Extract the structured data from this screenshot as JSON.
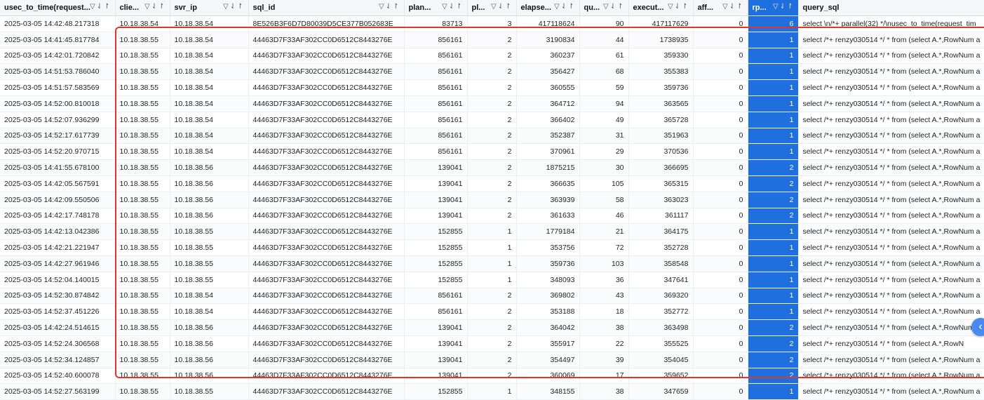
{
  "columns": [
    {
      "key": "usec",
      "label": "usec_to_time(request...",
      "num": false
    },
    {
      "key": "client",
      "label": "clie...",
      "num": false
    },
    {
      "key": "svr",
      "label": "svr_ip",
      "num": false
    },
    {
      "key": "sql",
      "label": "sql_id",
      "num": false
    },
    {
      "key": "plan",
      "label": "plan...",
      "num": true
    },
    {
      "key": "pl",
      "label": "pl...",
      "num": true
    },
    {
      "key": "elapse",
      "label": "elapse...",
      "num": true
    },
    {
      "key": "qu",
      "label": "qu...",
      "num": true
    },
    {
      "key": "execut",
      "label": "execut...",
      "num": true
    },
    {
      "key": "aff",
      "label": "aff...",
      "num": true
    },
    {
      "key": "rp",
      "label": "rp...",
      "num": true
    },
    {
      "key": "query",
      "label": "query_sql",
      "num": false
    }
  ],
  "header_icons": {
    "filter": "▽",
    "sort": "⇃↾"
  },
  "highlight_color": "#1f6fde",
  "selection_color": "#e0352b",
  "rows": [
    [
      "2025-03-05 14:42:48.217318",
      "10.18.38.54",
      "10.18.38.54",
      "8E526B3F6D7D80039D5CE377B052683E",
      "83713",
      "3",
      "417118624",
      "90",
      "417117629",
      "0",
      "6",
      "select \\n/*+ parallel(32) */\\nusec_to_time(request_tim"
    ],
    [
      "2025-03-05 14:41:45.817784",
      "10.18.38.55",
      "10.18.38.54",
      "44463D7F33AF302CC0D6512C8443276E",
      "856161",
      "2",
      "3190834",
      "44",
      "1738935",
      "0",
      "1",
      "select /*+ renzy030514 */ * from (select A.*,RowNum a"
    ],
    [
      "2025-03-05 14:42:01.720842",
      "10.18.38.55",
      "10.18.38.54",
      "44463D7F33AF302CC0D6512C8443276E",
      "856161",
      "2",
      "360237",
      "61",
      "359330",
      "0",
      "1",
      "select /*+ renzy030514 */ * from (select A.*,RowNum a"
    ],
    [
      "2025-03-05 14:51:53.786040",
      "10.18.38.55",
      "10.18.38.54",
      "44463D7F33AF302CC0D6512C8443276E",
      "856161",
      "2",
      "356427",
      "68",
      "355383",
      "0",
      "1",
      "select /*+ renzy030514 */ * from (select A.*,RowNum a"
    ],
    [
      "2025-03-05 14:51:57.583569",
      "10.18.38.55",
      "10.18.38.54",
      "44463D7F33AF302CC0D6512C8443276E",
      "856161",
      "2",
      "360555",
      "59",
      "359736",
      "0",
      "1",
      "select /*+ renzy030514 */ * from (select A.*,RowNum a"
    ],
    [
      "2025-03-05 14:52:00.810018",
      "10.18.38.55",
      "10.18.38.54",
      "44463D7F33AF302CC0D6512C8443276E",
      "856161",
      "2",
      "364712",
      "94",
      "363565",
      "0",
      "1",
      "select /*+ renzy030514 */ * from (select A.*,RowNum a"
    ],
    [
      "2025-03-05 14:52:07.936299",
      "10.18.38.55",
      "10.18.38.54",
      "44463D7F33AF302CC0D6512C8443276E",
      "856161",
      "2",
      "366402",
      "49",
      "365728",
      "0",
      "1",
      "select /*+ renzy030514 */ * from (select A.*,RowNum a"
    ],
    [
      "2025-03-05 14:52:17.617739",
      "10.18.38.55",
      "10.18.38.54",
      "44463D7F33AF302CC0D6512C8443276E",
      "856161",
      "2",
      "352387",
      "31",
      "351963",
      "0",
      "1",
      "select /*+ renzy030514 */ * from (select A.*,RowNum a"
    ],
    [
      "2025-03-05 14:52:20.970715",
      "10.18.38.55",
      "10.18.38.54",
      "44463D7F33AF302CC0D6512C8443276E",
      "856161",
      "2",
      "370961",
      "29",
      "370536",
      "0",
      "1",
      "select /*+ renzy030514 */ * from (select A.*,RowNum a"
    ],
    [
      "2025-03-05 14:41:55.678100",
      "10.18.38.55",
      "10.18.38.56",
      "44463D7F33AF302CC0D6512C8443276E",
      "139041",
      "2",
      "1875215",
      "30",
      "366695",
      "0",
      "2",
      "select /*+ renzy030514 */ * from (select A.*,RowNum a"
    ],
    [
      "2025-03-05 14:42:05.567591",
      "10.18.38.55",
      "10.18.38.56",
      "44463D7F33AF302CC0D6512C8443276E",
      "139041",
      "2",
      "366635",
      "105",
      "365315",
      "0",
      "2",
      "select /*+ renzy030514 */ * from (select A.*,RowNum a"
    ],
    [
      "2025-03-05 14:42:09.550506",
      "10.18.38.55",
      "10.18.38.56",
      "44463D7F33AF302CC0D6512C8443276E",
      "139041",
      "2",
      "363939",
      "58",
      "363023",
      "0",
      "2",
      "select /*+ renzy030514 */ * from (select A.*,RowNum a"
    ],
    [
      "2025-03-05 14:42:17.748178",
      "10.18.38.55",
      "10.18.38.56",
      "44463D7F33AF302CC0D6512C8443276E",
      "139041",
      "2",
      "361633",
      "46",
      "361117",
      "0",
      "2",
      "select /*+ renzy030514 */ * from (select A.*,RowNum a"
    ],
    [
      "2025-03-05 14:42:13.042386",
      "10.18.38.55",
      "10.18.38.55",
      "44463D7F33AF302CC0D6512C8443276E",
      "152855",
      "1",
      "1779184",
      "21",
      "364175",
      "0",
      "1",
      "select /*+ renzy030514 */ * from (select A.*,RowNum a"
    ],
    [
      "2025-03-05 14:42:21.221947",
      "10.18.38.55",
      "10.18.38.55",
      "44463D7F33AF302CC0D6512C8443276E",
      "152855",
      "1",
      "353756",
      "72",
      "352728",
      "0",
      "1",
      "select /*+ renzy030514 */ * from (select A.*,RowNum a"
    ],
    [
      "2025-03-05 14:42:27.961946",
      "10.18.38.55",
      "10.18.38.55",
      "44463D7F33AF302CC0D6512C8443276E",
      "152855",
      "1",
      "359736",
      "103",
      "358548",
      "0",
      "1",
      "select /*+ renzy030514 */ * from (select A.*,RowNum a"
    ],
    [
      "2025-03-05 14:52:04.140015",
      "10.18.38.55",
      "10.18.38.55",
      "44463D7F33AF302CC0D6512C8443276E",
      "152855",
      "1",
      "348093",
      "36",
      "347641",
      "0",
      "1",
      "select /*+ renzy030514 */ * from (select A.*,RowNum a"
    ],
    [
      "2025-03-05 14:52:30.874842",
      "10.18.38.55",
      "10.18.38.54",
      "44463D7F33AF302CC0D6512C8443276E",
      "856161",
      "2",
      "369802",
      "43",
      "369320",
      "0",
      "1",
      "select /*+ renzy030514 */ * from (select A.*,RowNum a"
    ],
    [
      "2025-03-05 14:52:37.451226",
      "10.18.38.55",
      "10.18.38.54",
      "44463D7F33AF302CC0D6512C8443276E",
      "856161",
      "2",
      "353188",
      "18",
      "352772",
      "0",
      "1",
      "select /*+ renzy030514 */ * from (select A.*,RowNum a"
    ],
    [
      "2025-03-05 14:42:24.514615",
      "10.18.38.55",
      "10.18.38.56",
      "44463D7F33AF302CC0D6512C8443276E",
      "139041",
      "2",
      "364042",
      "38",
      "363498",
      "0",
      "2",
      "select /*+ renzy030514 */ * from (select A.*,RowNum a"
    ],
    [
      "2025-03-05 14:52:24.306568",
      "10.18.38.55",
      "10.18.38.56",
      "44463D7F33AF302CC0D6512C8443276E",
      "139041",
      "2",
      "355917",
      "22",
      "355525",
      "0",
      "2",
      "select /*+ renzy030514 */ * from (select A.*,RowN"
    ],
    [
      "2025-03-05 14:52:34.124857",
      "10.18.38.55",
      "10.18.38.56",
      "44463D7F33AF302CC0D6512C8443276E",
      "139041",
      "2",
      "354497",
      "39",
      "354045",
      "0",
      "2",
      "select /*+ renzy030514 */ * from (select A.*,RowNum a"
    ],
    [
      "2025-03-05 14:52:40.600078",
      "10.18.38.55",
      "10.18.38.56",
      "44463D7F33AF302CC0D6512C8443276E",
      "139041",
      "2",
      "360069",
      "17",
      "359652",
      "0",
      "2",
      "select /*+ renzy030514 */ * from (select A.*,RowNum a"
    ],
    [
      "2025-03-05 14:52:27.563199",
      "10.18.38.55",
      "10.18.38.55",
      "44463D7F33AF302CC0D6512C8443276E",
      "152855",
      "1",
      "348155",
      "38",
      "347659",
      "0",
      "1",
      "select /*+ renzy030514 */ * from (select A.*,RowNum a"
    ]
  ]
}
